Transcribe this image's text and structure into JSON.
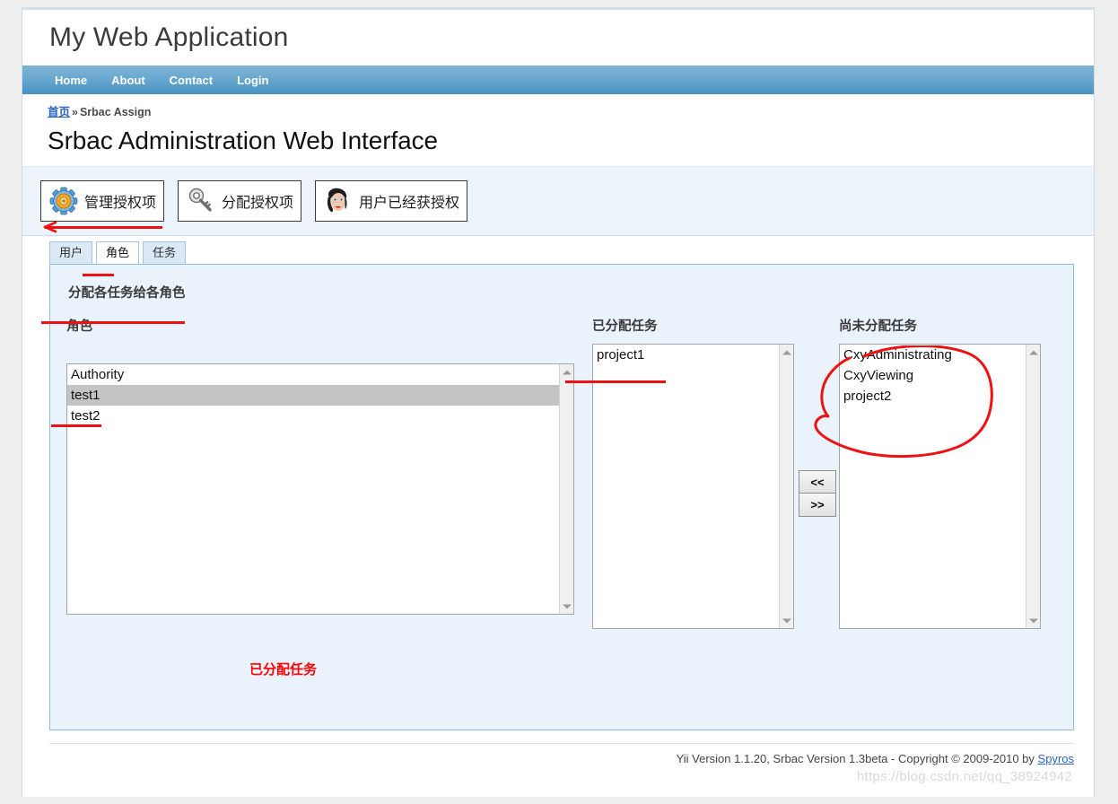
{
  "header": {
    "title": "My Web Application"
  },
  "nav": {
    "items": [
      {
        "label": "Home"
      },
      {
        "label": "About"
      },
      {
        "label": "Contact"
      },
      {
        "label": "Login"
      }
    ]
  },
  "breadcrumb": {
    "home_label": "首页",
    "separator": "»",
    "current": "Srbac Assign"
  },
  "page_title": "Srbac Administration Web Interface",
  "toolbar": {
    "buttons": [
      {
        "label": "管理授权项",
        "icon": "gear-icon"
      },
      {
        "label": "分配授权项",
        "icon": "key-icon"
      },
      {
        "label": "用户已经获授权",
        "icon": "face-avatar-icon"
      }
    ]
  },
  "tabs": [
    {
      "label": "用户",
      "active": false
    },
    {
      "label": "角色",
      "active": true
    },
    {
      "label": "任务",
      "active": false
    }
  ],
  "panel": {
    "heading": "分配各任务给各角色",
    "roles": {
      "label": "角色",
      "items": [
        {
          "label": "Authority",
          "selected": false
        },
        {
          "label": "test1",
          "selected": true
        },
        {
          "label": "test2",
          "selected": false
        }
      ]
    },
    "assigned": {
      "label": "已分配任务",
      "items": [
        {
          "label": "project1",
          "selected": false
        }
      ]
    },
    "unassigned": {
      "label": "尚未分配任务",
      "items": [
        {
          "label": "CxyAdministrating",
          "selected": false
        },
        {
          "label": "CxyViewing",
          "selected": false
        },
        {
          "label": "project2",
          "selected": false
        }
      ]
    },
    "transfer": {
      "move_left_label": "<<",
      "move_right_label": ">>"
    },
    "annotation_note": "已分配任务"
  },
  "footer": {
    "text": "Yii Version 1.1.20,  Srbac Version 1.3beta - Copyright © 2009-2010 by ",
    "link_label": "Spyros",
    "watermark": "https://blog.csdn.net/qq_38924942"
  },
  "colors": {
    "nav_top": "#7fb4d6",
    "nav_bottom": "#4591c3",
    "panel_bg": "#eaf2fb",
    "panel_border": "#8fbde0",
    "annotation_red": "#ee1111",
    "selection_gray": "#c4c4c4",
    "link_blue": "#2b62c6"
  }
}
